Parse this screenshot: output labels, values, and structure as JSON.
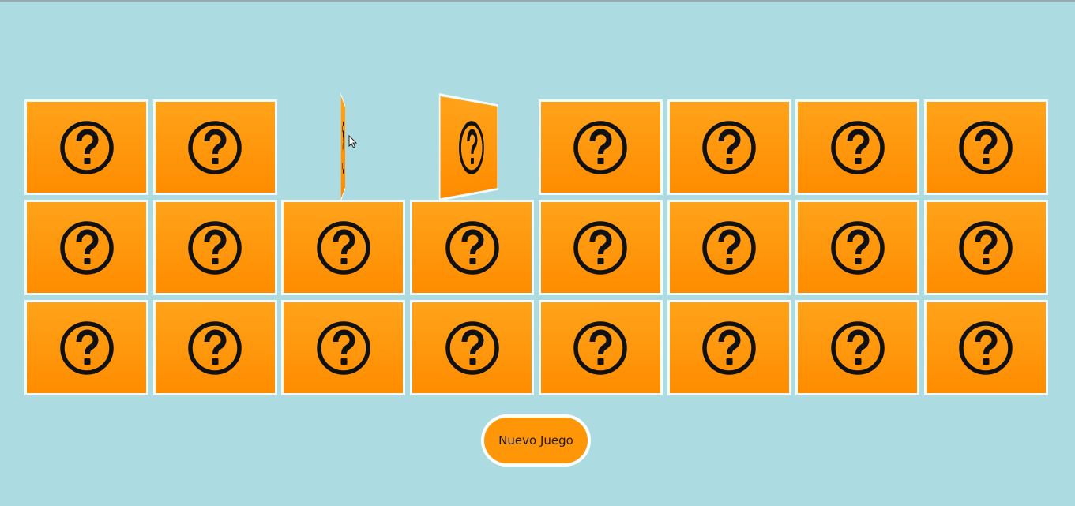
{
  "game": {
    "rows": 3,
    "columns": 8,
    "card_icon": "question-circle-icon",
    "colors": {
      "background": "#acdbe2",
      "card_face_top": "#ffa31a",
      "card_face_bottom": "#ff8c00",
      "card_border": "#f4fbfc",
      "icon": "#111111",
      "button": "#ff9608"
    },
    "cards": [
      {
        "state": "face-down"
      },
      {
        "state": "face-down"
      },
      {
        "state": "flipping-edge"
      },
      {
        "state": "flipping-half"
      },
      {
        "state": "face-down"
      },
      {
        "state": "face-down"
      },
      {
        "state": "face-down"
      },
      {
        "state": "face-down"
      },
      {
        "state": "face-down"
      },
      {
        "state": "face-down"
      },
      {
        "state": "face-down"
      },
      {
        "state": "face-down"
      },
      {
        "state": "face-down"
      },
      {
        "state": "face-down"
      },
      {
        "state": "face-down"
      },
      {
        "state": "face-down"
      },
      {
        "state": "face-down"
      },
      {
        "state": "face-down"
      },
      {
        "state": "face-down"
      },
      {
        "state": "face-down"
      },
      {
        "state": "face-down"
      },
      {
        "state": "face-down"
      },
      {
        "state": "face-down"
      },
      {
        "state": "face-down"
      }
    ]
  },
  "controls": {
    "new_game_label": "Nuevo Juego"
  }
}
